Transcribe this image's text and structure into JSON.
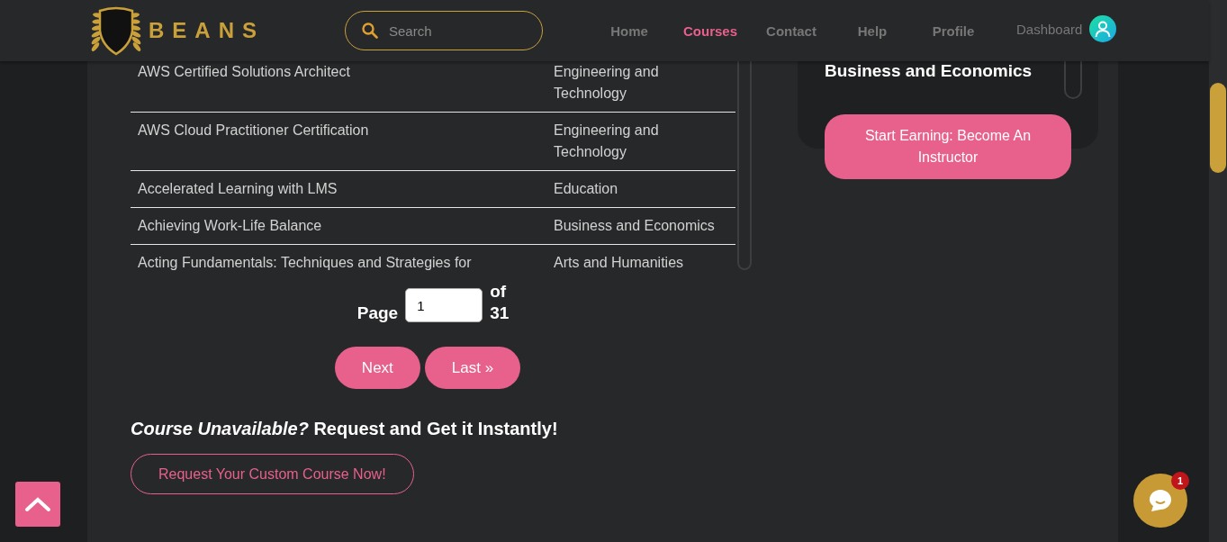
{
  "header": {
    "logo": "BEANS",
    "search": {
      "placeholder": "Search"
    },
    "nav": [
      {
        "label": "Home",
        "selected": false
      },
      {
        "label": "Courses",
        "selected": true
      },
      {
        "label": "Contact",
        "selected": false
      },
      {
        "label": "Help",
        "selected": false
      },
      {
        "label": "Profile",
        "selected": false
      }
    ],
    "dashboard": "Dashboard"
  },
  "courses": {
    "rows": [
      {
        "title": "AWS Certified Solutions Architect",
        "category": "Engineering and Technology"
      },
      {
        "title": "AWS Cloud Practitioner Certification",
        "category": "Engineering and Technology"
      },
      {
        "title": "Accelerated Learning with LMS",
        "category": "Education"
      },
      {
        "title": "Achieving Work-Life Balance",
        "category": "Business and Economics"
      },
      {
        "title": "Acting Fundamentals: Techniques and Strategies for",
        "category": "Arts and Humanities"
      }
    ]
  },
  "pagination": {
    "label": "Page",
    "value": "1",
    "of": "of",
    "total": "31",
    "buttons": [
      "Next",
      "Last »"
    ]
  },
  "sidebar": {
    "heading": "Business and Economics",
    "button": "Start Earning: Become An Instructor"
  },
  "request": {
    "heading": "*Course Unavailable?* Request and Get it Instantly!",
    "button": "Request Your Custom Course Now!"
  },
  "chat": {
    "badge": "1"
  }
}
